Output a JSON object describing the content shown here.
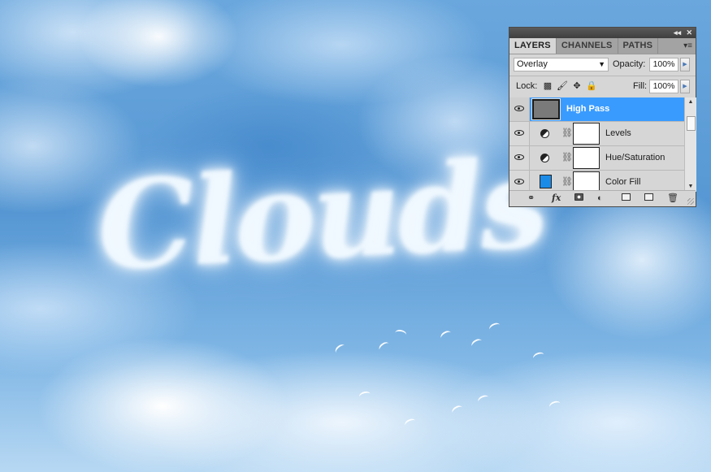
{
  "canvas": {
    "artwork_text": "Clouds",
    "colors": {
      "sky": "#5a9bd6",
      "cloud": "#f0f8ff"
    }
  },
  "layers_panel": {
    "titlebar": {
      "collapse_icon": "◂◂",
      "close_icon": "✕"
    },
    "tabs": [
      {
        "label": "LAYERS",
        "active": true
      },
      {
        "label": "CHANNELS",
        "active": false
      },
      {
        "label": "PATHS",
        "active": false
      }
    ],
    "menu_icon": "▾≡",
    "blend_mode": "Overlay",
    "opacity_label": "Opacity:",
    "opacity_value": "100%",
    "lock_label": "Lock:",
    "fill_label": "Fill:",
    "fill_value": "100%",
    "layers": [
      {
        "name": "High Pass",
        "type": "smart-filter",
        "visible": true,
        "selected": true
      },
      {
        "name": "Levels",
        "type": "adjustment",
        "visible": true,
        "selected": false
      },
      {
        "name": "Hue/Saturation",
        "type": "adjustment",
        "visible": true,
        "selected": false
      },
      {
        "name": "Color Fill",
        "type": "fill",
        "visible": true,
        "selected": false,
        "color": "#1b8be8"
      }
    ],
    "selected_color": "#3a9bff",
    "bottom_icons": [
      "link-layers",
      "fx",
      "add-mask",
      "new-adjustment",
      "new-group",
      "new-layer",
      "delete-layer"
    ]
  }
}
